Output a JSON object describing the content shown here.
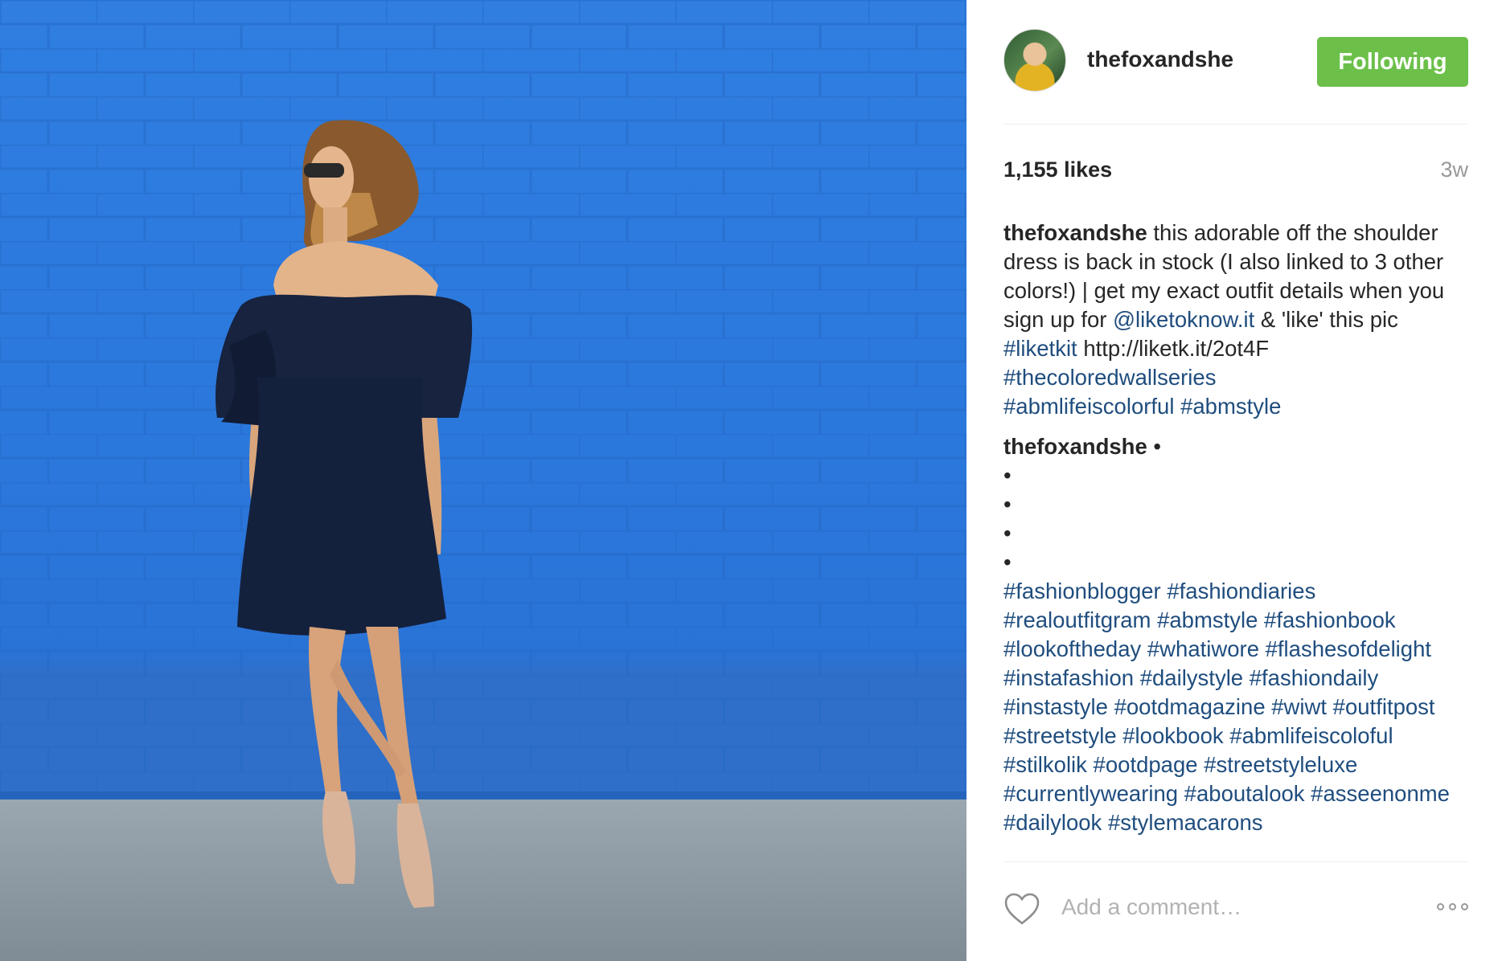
{
  "photo": {
    "alt_icon": "woman-in-navy-dress-photo",
    "wall_color": "#2b78dd",
    "dress_color": "#14213d"
  },
  "header": {
    "avatar_icon": "avatar-image",
    "username": "thefoxandshe",
    "follow_label": "Following",
    "follow_color": "#6cc04a"
  },
  "stats": {
    "likes": "1,155 likes",
    "time_ago": "3w"
  },
  "caption": {
    "user": "thefoxandshe",
    "text_1": " this adorable off the shoulder dress is back in stock (I also linked to 3 other colors!) | get my exact outfit details when you sign up for ",
    "mention": "@liketoknow.it",
    "text_2": " & 'like' this pic ",
    "tag_1": "#liketkit",
    "text_3": " http://liketk.it/2ot4F ",
    "tag_2": "#thecoloredwallseries",
    "tags_3": "#abmlifeiscolorful #abmstyle"
  },
  "second_comment": {
    "user": "thefoxandshe",
    "dots": " •\n•\n•\n•\n•",
    "hashtags": "#fashionblogger #fashiondiaries #realoutfitgram #abmstyle #fashionbook #lookoftheday #whatiwore #flashesofdelight #instafashion #dailystyle #fashiondaily #instastyle #ootdmagazine #wiwt #outfitpost #streetstyle #lookbook #abmlifeiscoloful #stilkolik #ootdpage #streetstyleluxe #currentlywearing #aboutalook #asseenonme #dailylook #stylemacarons"
  },
  "comment_bar": {
    "like_icon": "heart-icon",
    "placeholder": "Add a comment…",
    "more_icon": "more-options-icon"
  },
  "colors": {
    "link": "#1f4d7e",
    "muted": "#999999"
  }
}
